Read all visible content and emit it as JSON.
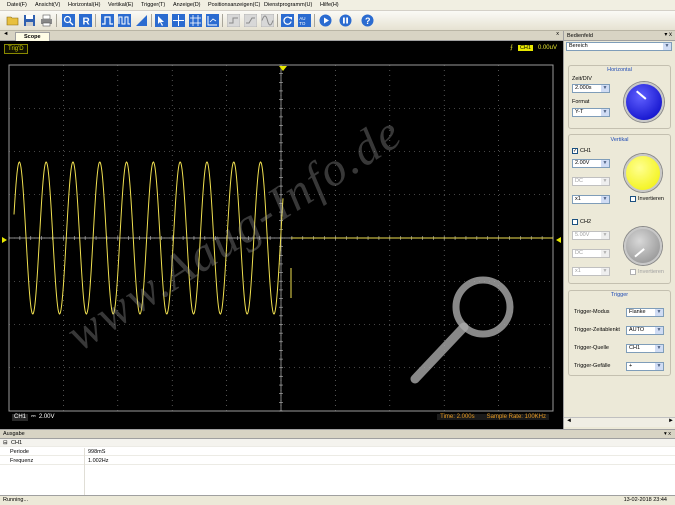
{
  "menu": [
    "Datei(F)",
    "Ansicht(V)",
    "Horizontal(H)",
    "Vertikal(E)",
    "Trigger(T)",
    "Anzeige(D)",
    "Positionsanzeigen(C)",
    "Dienstprogramm(U)",
    "Hilfe(H)"
  ],
  "tabs": {
    "arrow": "◄",
    "scope": "Scope",
    "close": "x"
  },
  "scope": {
    "trig_label": "Trig'D",
    "trigger_level": "0.00uV",
    "channel_tag": "CH1",
    "channel_scale": "2.00V",
    "time": "Time: 2.000s",
    "sample_rate": "Sample Rate: 100KHz",
    "watermark": "www.Aaug-Info.de",
    "trace_color": "#f0e050",
    "grid_color": "#8a8a8a"
  },
  "panel": {
    "title": "Bedienfeld",
    "bereich": "Bereich",
    "horizontal": {
      "title": "Horizontal",
      "zeit_label": "Zeit/DIV",
      "zeit_value": "2.000s",
      "format_label": "Format",
      "format_value": "Y-T",
      "knob_color": "#0000c8"
    },
    "vertikal": {
      "title": "Vertikal",
      "ch1_label": "CH1",
      "ch1_volts": "2.00V",
      "ch1_coupling": "DC",
      "ch1_probe": "x1",
      "ch1_invert": "Invertieren",
      "ch1_knob_color": "#ffff00",
      "ch2_label": "CH2",
      "ch2_volts": "5.00V",
      "ch2_coupling": "DC",
      "ch2_probe": "x1",
      "ch2_invert": "Invertieren",
      "ch2_knob_color": "#b0b0b0"
    },
    "trigger": {
      "title": "Trigger",
      "modus_label": "Trigger-Modus",
      "modus_value": "Flanke",
      "zeit_label": "Trigger-Zeitablenkt",
      "zeit_value": "AUTO",
      "quelle_label": "Trigger-Quelle",
      "quelle_value": "CH1",
      "gefaelle_label": "Trigger-Gefälle",
      "gefaelle_value": "+"
    }
  },
  "output": {
    "title": "Ausgabe",
    "channel": "CH1",
    "rows": [
      {
        "label": "Periode",
        "value": "998mS"
      },
      {
        "label": "Frequenz",
        "value": "1.002Hz"
      }
    ]
  },
  "status": {
    "left": "Running...",
    "right": "13-02-2018  23:44"
  }
}
